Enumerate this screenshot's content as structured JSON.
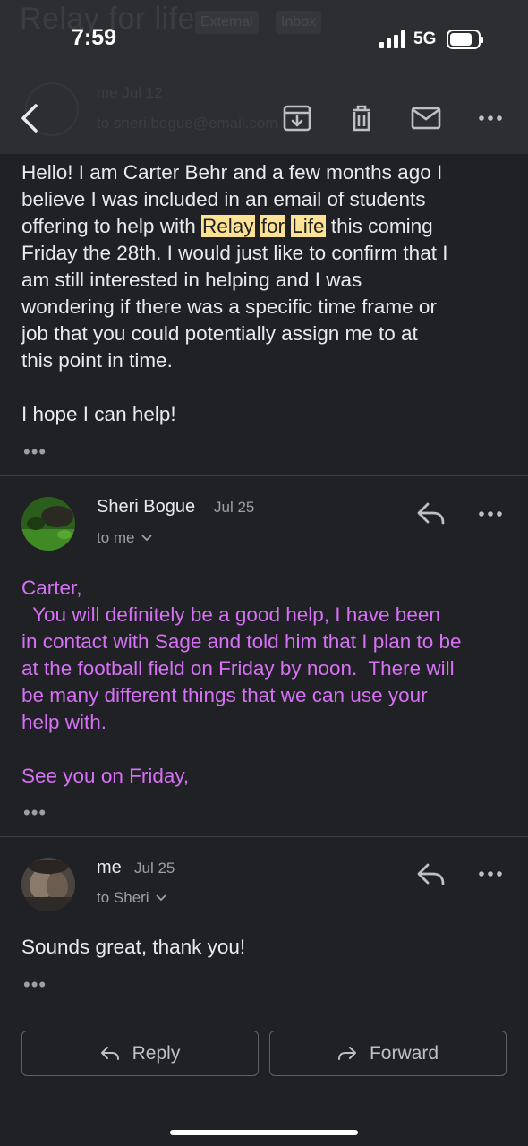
{
  "status_bar": {
    "time": "7:59",
    "network": "5G"
  },
  "header_background": {
    "subject": "Relay for life",
    "chips": [
      "External",
      "Inbox"
    ],
    "from": "me  Jul 12",
    "to_line": "to sheri.bogue@email.com"
  },
  "toolbar": {
    "icons": [
      "back-icon",
      "archive-icon",
      "delete-icon",
      "mark-unread-icon",
      "more-icon"
    ]
  },
  "message1": {
    "line1": "Hello! I am Carter Behr and a few months ago I",
    "line2": "believe I was included in an email of students",
    "line3_pre": "offering to help with ",
    "hl1": "Relay",
    "hl2": "for",
    "hl3": "Life",
    "line3_post": " this coming",
    "line4": "Friday the 28th. I would just like to confirm that I",
    "line5": "am still interested in helping and I was",
    "line6": "wondering if there was a specific time frame or",
    "line7": "job that you could potentially assign me to at",
    "line8": "this point in time.",
    "closing": "I hope I can help!",
    "more": "•••"
  },
  "message2": {
    "sender": "Sheri Bogue",
    "date": "Jul 25",
    "recipient": "to me",
    "line1": "Carter,",
    "line2": "  You will definitely be a good help, I have been",
    "line3": "in contact with Sage and told him that I plan to be",
    "line4": "at the football field on Friday by noon.  There will",
    "line5": "be many different things that we can use your",
    "line6": "help with.",
    "closing": "See you on Friday,",
    "more": "•••"
  },
  "message3": {
    "sender": "me",
    "date": "Jul 25",
    "recipient": "to Sheri",
    "body": "Sounds great, thank you!",
    "more": "•••"
  },
  "actions": {
    "reply": "Reply",
    "forward": "Forward"
  },
  "colors": {
    "background": "#202124",
    "header": "#2d2e31",
    "highlight": "#fde293",
    "quoted_text": "#d671f5"
  }
}
